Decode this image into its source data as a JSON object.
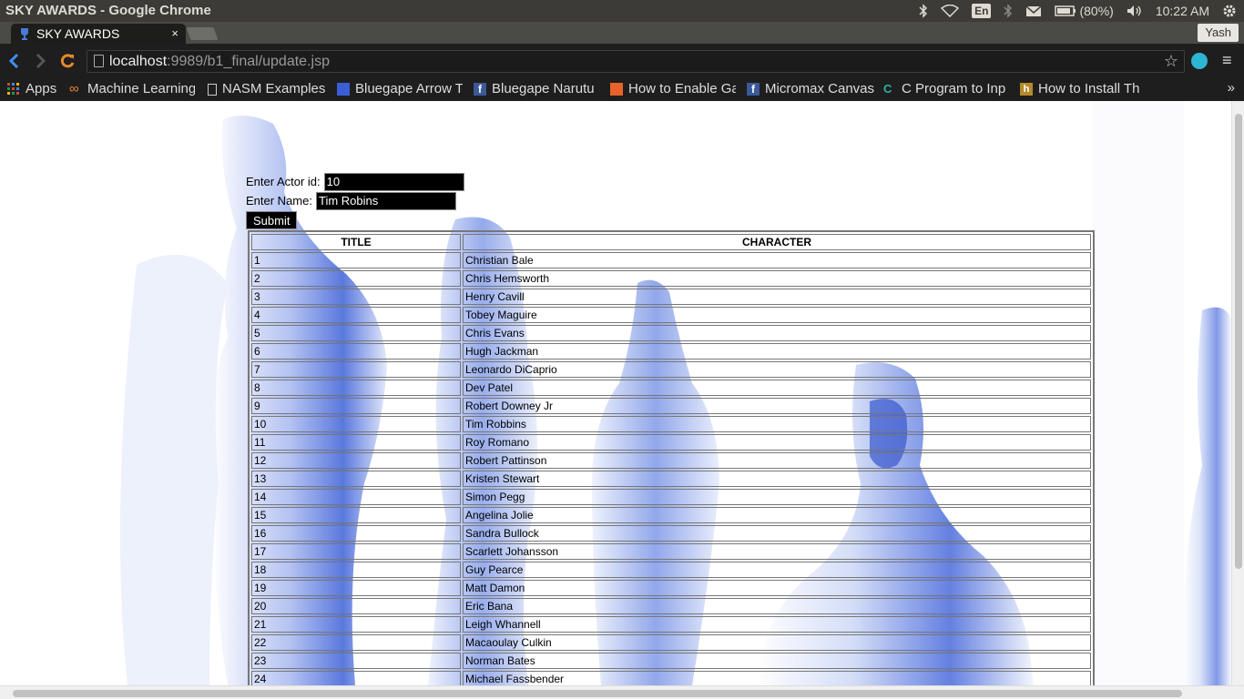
{
  "os": {
    "window_title": "SKY AWARDS - Google Chrome",
    "battery": "(80%)",
    "clock": "10:22 AM",
    "keyboard_layout": "En"
  },
  "browser": {
    "tab_title": "SKY AWARDS",
    "tab_close": "×",
    "profile_name": "Yash",
    "url_host": "localhost",
    "url_path": ":9989/b1_final/update.jsp",
    "bookmarks": [
      {
        "label": "Apps",
        "icon": "apps-grid-icon",
        "color": "#d14836"
      },
      {
        "label": "Machine Learning",
        "icon": "infinity-icon",
        "color": "#e8833a"
      },
      {
        "label": "NASM Examples",
        "icon": "page-icon",
        "color": "#cccccc"
      },
      {
        "label": "Bluegape Arrow T",
        "icon": "bluegape-icon",
        "color": "#3b5ed6"
      },
      {
        "label": "Bluegape Narutu",
        "icon": "facebook-icon",
        "color": "#3b5998"
      },
      {
        "label": "How to Enable Ga",
        "icon": "box-icon",
        "color": "#e8622a"
      },
      {
        "label": "Micromax Canvas",
        "icon": "facebook-icon",
        "color": "#3b5998"
      },
      {
        "label": "C Program to Inp",
        "icon": "c-program-icon",
        "color": "#2bb3a3"
      },
      {
        "label": "How to Install Th",
        "icon": "h-icon",
        "color": "#b58a2a"
      }
    ],
    "bookmarks_overflow": "»"
  },
  "form": {
    "actor_id_label": "Enter Actor id:",
    "actor_id_value": "10",
    "name_label": "Enter Name:",
    "name_value": "Tim Robins",
    "submit_label": "Submit"
  },
  "table": {
    "headers": [
      "TITLE",
      "CHARACTER"
    ],
    "rows": [
      [
        "1",
        "Christian Bale"
      ],
      [
        "2",
        "Chris Hemsworth"
      ],
      [
        "3",
        "Henry Cavill"
      ],
      [
        "4",
        "Tobey Maguire"
      ],
      [
        "5",
        "Chris Evans"
      ],
      [
        "6",
        "Hugh Jackman"
      ],
      [
        "7",
        "Leonardo DiCaprio"
      ],
      [
        "8",
        "Dev Patel"
      ],
      [
        "9",
        "Robert Downey Jr"
      ],
      [
        "10",
        "Tim Robbins"
      ],
      [
        "11",
        "Roy Romano"
      ],
      [
        "12",
        "Robert Pattinson"
      ],
      [
        "13",
        "Kristen Stewart"
      ],
      [
        "14",
        "Simon Pegg"
      ],
      [
        "15",
        "Angelina Jolie"
      ],
      [
        "16",
        "Sandra Bullock"
      ],
      [
        "17",
        "Scarlett Johansson"
      ],
      [
        "18",
        "Guy Pearce"
      ],
      [
        "19",
        "Matt Damon"
      ],
      [
        "20",
        "Eric Bana"
      ],
      [
        "21",
        "Leigh Whannell"
      ],
      [
        "22",
        "Macaoulay Culkin"
      ],
      [
        "23",
        "Norman Bates"
      ],
      [
        "24",
        "Michael Fassbender"
      ]
    ]
  },
  "colors": {
    "statue_blue": "#3f62d8",
    "chrome_dark": "#1e1e1e",
    "os_bar": "#3c3b37"
  }
}
